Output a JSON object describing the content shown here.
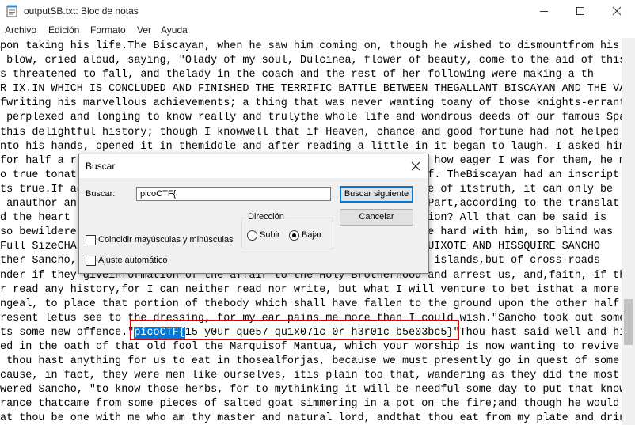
{
  "window": {
    "title": "outputSB.txt: Bloc de notas",
    "minimize_icon": "minimize-icon",
    "maximize_icon": "maximize-icon",
    "close_icon": "close-icon"
  },
  "menu": [
    "Archivo",
    "Edición",
    "Formato",
    "Ver",
    "Ayuda"
  ],
  "editor": {
    "lines": [
      "pon taking his life.The Biscayan, when he saw him coming on, though he wished to dismountfrom his",
      " blow, cried aloud, saying, \"Olady of my soul, Dulcinea, flower of beauty, come to the aid of this",
      "s threatened to fall, and thelady in the coach and the rest of her following were making a th",
      "R IX.IN WHICH IS CONCLUDED AND FINISHED THE TERRIFIC BATTLE BETWEEN THEGALLANT BISCAYAN AND THE VA",
      "fwriting his marvellous achievements; a thing that was never wanting toany of those knights-errant",
      " perplexed and longing to know really and trulythe whole life and wondrous deeds of our famous Spa",
      "this delightful history; though I knowwell that if Heaven, chance and good fortune had not helped",
      "nto his hands, opened it in themiddle and after reading a little in it began to laugh. I asked him",
      "for half a r                                                        how eager I was for them, he m",
      "o true tonat                                                      ff. TheBiscayan had an inscript",
      "ts true.If ag                                                    ore of itstruth, it can only be",
      " anauthor an                                                       Part,according to the translat",
      "d the heart                                                    fashion? All that can be said is",
      "so bewildere                                                    gone hard with him, so blind was",
      "Full SizeCHA                                                    N QUIXOTE AND HISSQUIRE SANCHO",
      "ther Sancho,                                                   s of islands,but of cross-roads",
      "nder if they giveinformation of the affair to the Holy Brotherhood and arrest us, and,faith, if th",
      "r read any history,for I can neither read nor write, but what I will venture to bet isthat a more",
      "ngeal, to place that portion of thebody which shall have fallen to the ground upon the other half",
      "resent letus see to the dressing, for my ear pains me more than I could wish.\"Sancho took out some",
      "ts some new offence.\"",
      "ed in the oath of that old fool the Marquisof Mantua, which your worship is now wanting to revive",
      " thou hast anything for us to eat in thosealforjas, because we must presently go in quest of some",
      "cause, in fact, they were men like ourselves, itis plain too that, wandering as they did the most",
      "wered Sancho, \"to know those herbs, for to mythinking it will be needful some day to put that know",
      "rance thatcame from some pieces of salted goat simmering in a pot on the fire;and though he would",
      "at thou be one with me who am thy master and natural lord, andthat thou eat from my plate and drin"
    ],
    "flag_selected": "picoCTF{",
    "flag_rest": "15_y0ur_que57_qu1x071c_0r_h3r01c_b5e03bc5}",
    "after_flag": "\"Thou hast said well and his"
  },
  "dialog": {
    "title": "Buscar",
    "search_label": "Buscar:",
    "search_value": "picoCTF{",
    "find_next": "Buscar siguiente",
    "cancel": "Cancelar",
    "direction_label": "Dirección",
    "up": "Subir",
    "down": "Bajar",
    "direction_selected": "down",
    "match_case_label": "Coincidir mayúsculas y minúsculas",
    "match_case_checked": false,
    "wrap_label": "Ajuste automático",
    "wrap_checked": false
  },
  "colors": {
    "selection": "#0078d7",
    "highlight_box": "#e00000"
  }
}
